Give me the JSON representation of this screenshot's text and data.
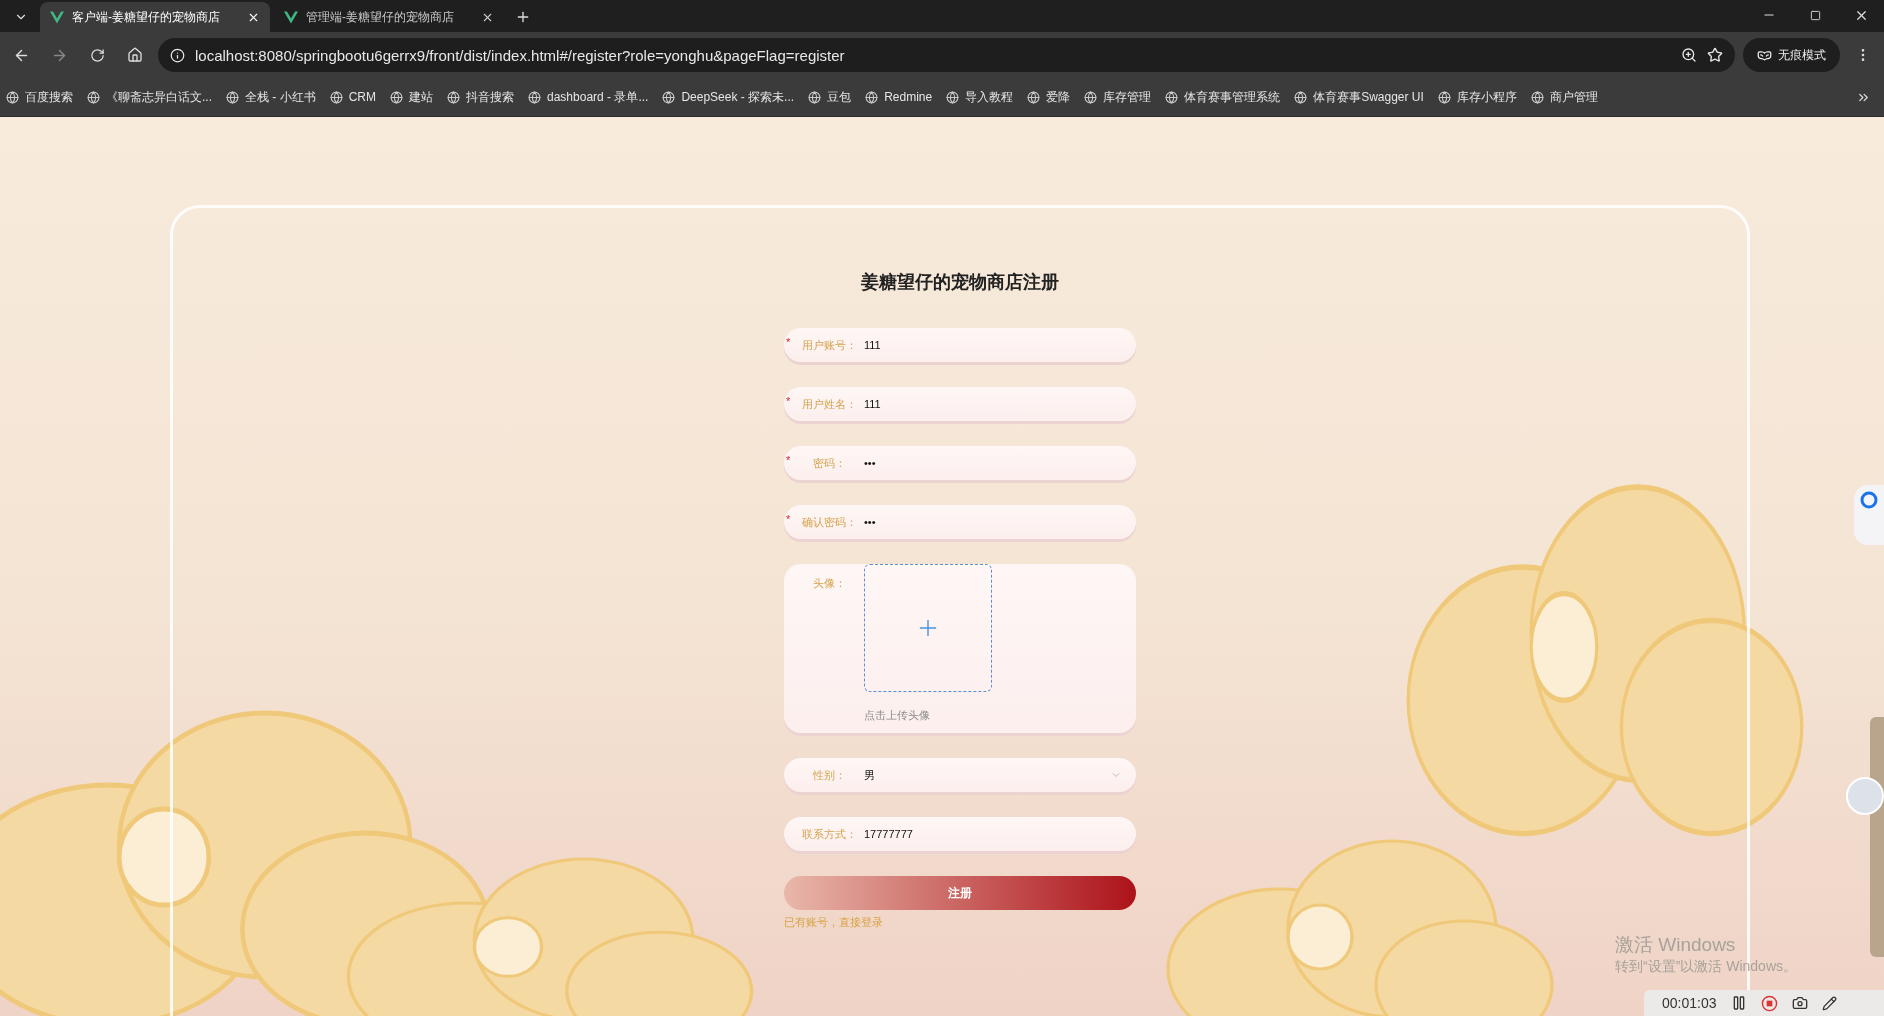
{
  "browser": {
    "tabs": [
      {
        "title": "客户端-姜糖望仔的宠物商店",
        "selected": true
      },
      {
        "title": "管理端-姜糖望仔的宠物商店",
        "selected": false
      }
    ],
    "address": "localhost:8080/springbootu6gerrx9/front/dist/index.html#/register?role=yonghu&pageFlag=register",
    "incognito": "无痕模式",
    "bookmarks": [
      "百度搜索",
      "《聊斋志异白话文...",
      "全栈 - 小红书",
      "CRM",
      "建站",
      "抖音搜索",
      "dashboard - 录单...",
      "DeepSeek - 探索未...",
      "豆包",
      "Redmine",
      "导入教程",
      "爱降",
      "库存管理",
      "体育赛事管理系统",
      "体育赛事Swagger UI",
      "库存小程序",
      "商户管理"
    ]
  },
  "form": {
    "title": "姜糖望仔的宠物商店注册",
    "fields": [
      {
        "kind": "text",
        "label": "用户账号：",
        "required": true,
        "value": "111"
      },
      {
        "kind": "text",
        "label": "用户姓名：",
        "required": true,
        "value": "111"
      },
      {
        "kind": "text",
        "label": "密码：",
        "required": true,
        "value": "•••"
      },
      {
        "kind": "text",
        "label": "确认密码：",
        "required": true,
        "value": "•••"
      },
      {
        "kind": "upload",
        "label": "头像：",
        "required": false,
        "hint": "点击上传头像"
      },
      {
        "kind": "select",
        "label": "性别：",
        "required": false,
        "value": "男"
      },
      {
        "kind": "text",
        "label": "联系方式：",
        "required": false,
        "value": "17777777"
      }
    ],
    "required_mark": "*",
    "submit": "注册",
    "login_link": "已有账号，直接登录"
  },
  "windows_notice": {
    "title": "激活 Windows",
    "subtitle": "转到“设置”以激活 Windows。"
  },
  "recorder": {
    "time": "00:01:03"
  }
}
